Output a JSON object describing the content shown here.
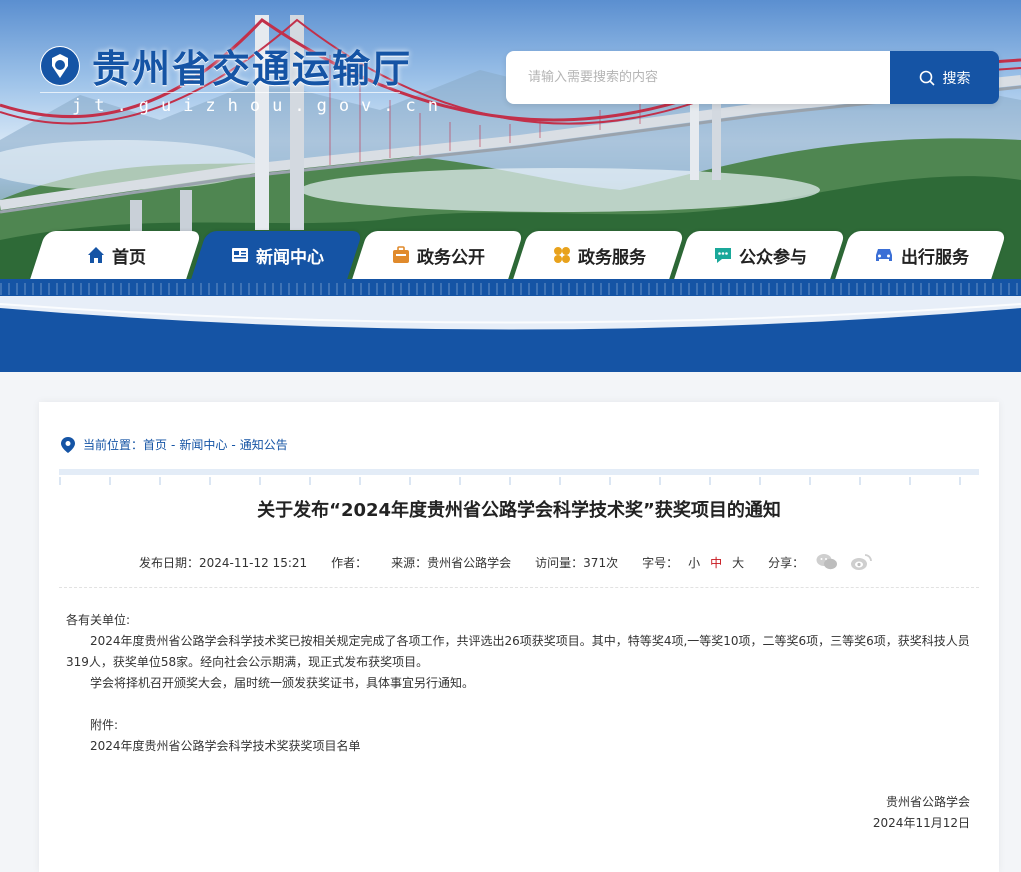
{
  "header": {
    "site_title": "贵州省交通运输厅",
    "site_domain": "jt.guizhou.gov.cn",
    "search_placeholder": "请输入需要搜索的内容",
    "search_button": "搜索"
  },
  "nav": [
    {
      "label": "首页",
      "icon": "home-icon",
      "active": false
    },
    {
      "label": "新闻中心",
      "icon": "news-icon",
      "active": true
    },
    {
      "label": "政务公开",
      "icon": "briefcase-icon",
      "active": false
    },
    {
      "label": "政务服务",
      "icon": "grid-flower-icon",
      "active": false
    },
    {
      "label": "公众参与",
      "icon": "chat-icon",
      "active": false
    },
    {
      "label": "出行服务",
      "icon": "car-icon",
      "active": false
    }
  ],
  "breadcrumb": {
    "prefix": "当前位置：",
    "items": [
      "首页",
      "新闻中心",
      "通知公告"
    ],
    "separator": "-"
  },
  "article": {
    "title": "关于发布“2024年度贵州省公路学会科学技术奖”获奖项目的通知",
    "publish_date": "发布日期：2024-11-12 15:21",
    "author": "作者：",
    "source": "来源：贵州省公路学会",
    "views": "访问量：371次",
    "font_size_label": "字号：",
    "font_sizes": [
      "小",
      "中",
      "大"
    ],
    "share_label": "分享：",
    "salutation": "各有关单位:",
    "para1": "2024年度贵州省公路学会科学技术奖已按相关规定完成了各项工作，共评选出26项获奖项目。其中，特等奖4项,一等奖10项，二等奖6项，三等奖6项，获奖科技人员319人，获奖单位58家。经向社会公示期满，现正式发布获奖项目。",
    "para2": "学会将择机召开颁奖大会，届时统一颁发获奖证书，具体事宜另行通知。",
    "attachment_label": "附件:",
    "attachment_name": "2024年度贵州省公路学会科学技术奖获奖项目名单",
    "signature_org": "贵州省公路学会",
    "signature_date": "2024年11月12日"
  },
  "colors": {
    "brand_blue": "#1554a5",
    "accent_red": "#c8161d"
  }
}
